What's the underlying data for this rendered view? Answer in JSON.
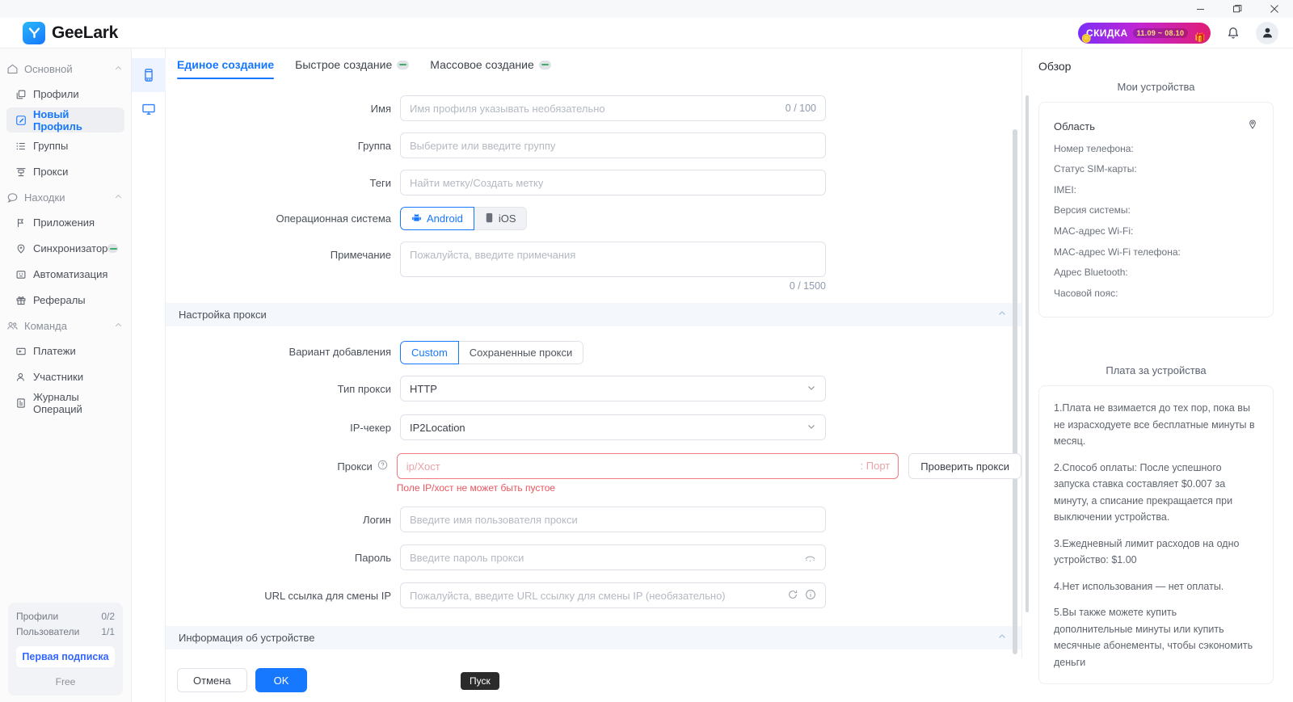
{
  "window": {
    "minimize_label": "Свернуть",
    "maximize_label": "Развернуть",
    "close_label": "Закрыть"
  },
  "header": {
    "brand": "GeeLark",
    "promo": {
      "title": "СКИДКА",
      "dates": "11.09 ~ 08.10"
    },
    "notifications_label": "Уведомления",
    "account_label": "Аккаунт"
  },
  "sidebar": {
    "groups": [
      {
        "label": "Основной",
        "items": [
          {
            "label": "Профили",
            "icon": "profiles-icon",
            "active": false
          },
          {
            "label": "Новый Профиль",
            "icon": "new-profile-icon",
            "active": true
          },
          {
            "label": "Группы",
            "icon": "groups-icon",
            "active": false
          },
          {
            "label": "Прокси",
            "icon": "proxy-icon",
            "active": false
          }
        ]
      },
      {
        "label": "Находки",
        "items": [
          {
            "label": "Приложения",
            "icon": "apps-icon",
            "active": false
          },
          {
            "label": "Синхронизатор",
            "icon": "sync-icon",
            "active": false,
            "badge": true
          },
          {
            "label": "Автоматизация",
            "icon": "automation-icon",
            "active": false
          },
          {
            "label": "Рефералы",
            "icon": "referral-icon",
            "active": false
          }
        ]
      },
      {
        "label": "Команда",
        "items": [
          {
            "label": "Платежи",
            "icon": "payments-icon",
            "active": false
          },
          {
            "label": "Участники",
            "icon": "members-icon",
            "active": false
          },
          {
            "label": "Журналы Операций",
            "icon": "logs-icon",
            "active": false
          }
        ]
      }
    ],
    "quota": {
      "profiles_label": "Профили",
      "profiles_value": "0/2",
      "users_label": "Пользователи",
      "users_value": "1/1",
      "subscribe_button": "Первая подписка",
      "plan": "Free"
    }
  },
  "rail": {
    "items": [
      {
        "name": "phone-device-icon",
        "active": true
      },
      {
        "name": "desktop-device-icon",
        "active": false
      }
    ]
  },
  "main": {
    "tabs": [
      {
        "label": "Единое создание",
        "active": true,
        "badge": false
      },
      {
        "label": "Быстрое создание",
        "active": false,
        "badge": true
      },
      {
        "label": "Массовое создание",
        "active": false,
        "badge": true
      }
    ],
    "fields": {
      "name_label": "Имя",
      "name_placeholder": "Имя профиля указывать необязательно",
      "name_counter": "0 / 100",
      "group_label": "Группа",
      "group_placeholder": "Выберите или введите группу",
      "tags_label": "Теги",
      "tags_placeholder": "Найти метку/Создать метку",
      "os_label": "Операционная система",
      "os_android": "Android",
      "os_ios": "iOS",
      "note_label": "Примечание",
      "note_placeholder": "Пожалуйста, введите примечания",
      "note_counter": "0 / 1500"
    },
    "proxy_section": {
      "title": "Настройка прокси",
      "variant_label": "Вариант добавления",
      "variant_custom": "Custom",
      "variant_saved": "Сохраненные прокси",
      "type_label": "Тип прокси",
      "type_value": "HTTP",
      "checker_label": "IP-чекер",
      "checker_value": "IP2Location",
      "proxy_label": "Прокси",
      "proxy_host_placeholder": "ip/Хост",
      "proxy_port_placeholder": ": Порт",
      "check_button": "Проверить прокси",
      "proxy_error": "Поле IP/хост не может быть пустое",
      "login_label": "Логин",
      "login_placeholder": "Введите имя пользователя прокси",
      "password_label": "Пароль",
      "password_placeholder": "Введите пароль прокси",
      "url_label": "URL ссылка для смены IP",
      "url_placeholder": "Пожалуйста, введите URL ссылку для смены IP (необязательно)"
    },
    "device_section": {
      "title": "Информация об устройстве"
    },
    "footer": {
      "cancel": "Отмена",
      "ok": "OK",
      "tooltip": "Пуск"
    }
  },
  "right": {
    "title": "Обзор",
    "devices_heading": "Мои устройства",
    "device_rows": [
      "Область",
      "Номер телефона:",
      "Статус SIM-карты:",
      "IMEI:",
      "Версия системы:",
      "MAC-адрес Wi-Fi:",
      "MAC-адрес Wi-Fi телефона:",
      "Адрес Bluetooth:",
      "Часовой пояс:"
    ],
    "fee_heading": "Плата за устройства",
    "fee_items": [
      "1.Плата не взимается до тех пор, пока вы не израсходуете все бесплатные минуты в месяц.",
      "2.Способ оплаты: После успешного запуска ставка составляет $0.007 за минуту, а списание прекращается при выключении устройства.",
      "3.Ежедневный лимит расходов на одно устройство: $1.00",
      "4.Нет использования — нет оплаты.",
      "5.Вы также можете купить дополнительные минуты или купить месячные абонементы, чтобы сэкономить деньги"
    ]
  },
  "colors": {
    "accent": "#1677ff",
    "error": "#e8565f",
    "sidebar_bg": "#fbfbfc"
  }
}
